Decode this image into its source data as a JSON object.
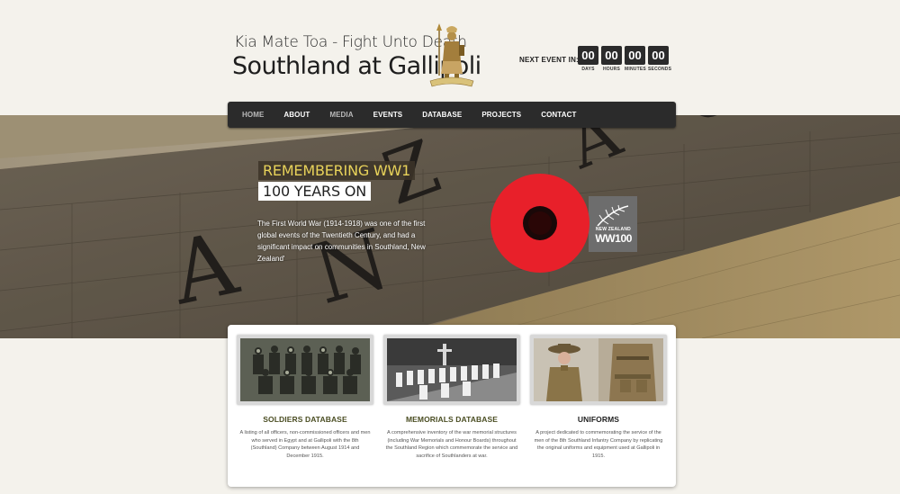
{
  "header": {
    "tagline": "Kia Mate Toa - Fight Unto Death",
    "site_title": "Southland at Gallipoli",
    "countdown_label": "NEXT EVENT IN:",
    "countdown": [
      {
        "value": "00",
        "unit": "DAYS"
      },
      {
        "value": "00",
        "unit": "HOURS"
      },
      {
        "value": "00",
        "unit": "MINUTES"
      },
      {
        "value": "00",
        "unit": "SECONDS"
      }
    ]
  },
  "nav": {
    "items": [
      "HOME",
      "ABOUT",
      "MEDIA",
      "EVENTS",
      "DATABASE",
      "PROJECTS",
      "CONTACT"
    ]
  },
  "hero": {
    "wall_text": "ANZAC",
    "heading_1": "REMEMBERING WW1",
    "heading_2": "100 YEARS ON",
    "intro": "The First World War (1914-1918) was one of the first global events of the Twentieth Century, and had a significant impact on communities in Southland, New Zealand'",
    "badge_country": "NEW ZEALAND",
    "badge_name": "WW100",
    "poppy_color": "#e8202a"
  },
  "cards": [
    {
      "title": "SOLDIERS DATABASE",
      "title_color": "#4a4d22",
      "body": "A listing of all officers, non-commissioned officers and men who served in Egypt and at Gallipoli with the 8th (Southland) Company between August 1914 and December 1915."
    },
    {
      "title": "MEMORIALS DATABASE",
      "title_color": "#4a4d22",
      "body": "A comprehensive inventory of the war memorial structures (including War Memorials and Honour Boards) throughout the Southland Region which commemorate the service and sacrifice of Southlanders at war."
    },
    {
      "title": "UNIFORMS",
      "title_color": "#222222",
      "body": "A project dedicated to commemorating the service of the men of the 8th Southland Infantry Company by replicating the original uniforms and equipment used at Gallipoli in 1915."
    }
  ]
}
